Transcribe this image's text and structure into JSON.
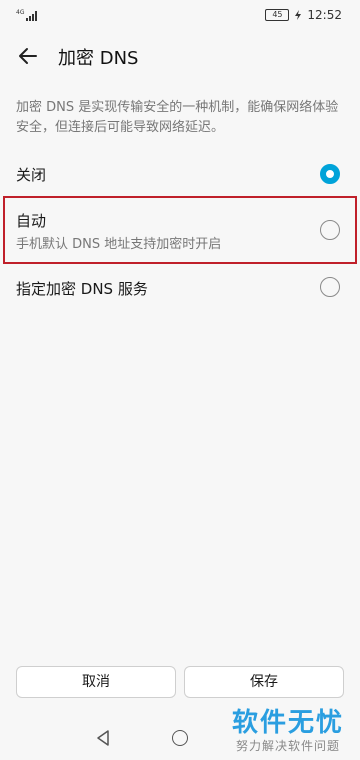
{
  "status_bar": {
    "network": "4G",
    "battery": "45",
    "time": "12:52"
  },
  "header": {
    "title": "加密 DNS"
  },
  "description": "加密 DNS 是实现传输安全的一种机制，能确保网络体验安全，但连接后可能导致网络延迟。",
  "options": [
    {
      "title": "关闭",
      "subtitle": "",
      "selected": true
    },
    {
      "title": "自动",
      "subtitle": "手机默认 DNS 地址支持加密时开启",
      "selected": false
    },
    {
      "title": "指定加密 DNS 服务",
      "subtitle": "",
      "selected": false
    }
  ],
  "buttons": {
    "cancel": "取消",
    "save": "保存"
  },
  "watermark": {
    "title": "软件无忧",
    "subtitle": "努力解决软件问题"
  },
  "colors": {
    "accent": "#00a3d9",
    "highlight": "#c0202a"
  }
}
